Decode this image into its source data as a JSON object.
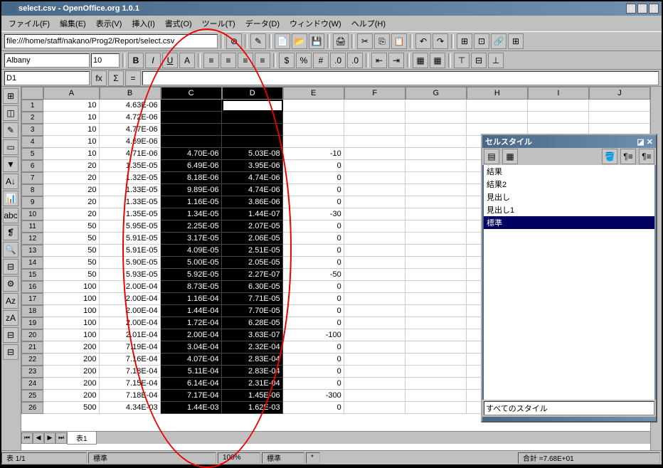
{
  "title": "select.csv - OpenOffice.org 1.0.1",
  "menus": [
    "ファイル(F)",
    "編集(E)",
    "表示(V)",
    "挿入(I)",
    "書式(O)",
    "ツール(T)",
    "データ(D)",
    "ウィンドウ(W)",
    "ヘルプ(H)"
  ],
  "url": "file:///home/staff/nakano/Prog2/Report/select.csv",
  "font": "Albany",
  "fontsize": "10",
  "cellref": "D1",
  "formula": "",
  "columns": [
    "A",
    "B",
    "C",
    "D",
    "E",
    "F",
    "G",
    "H",
    "I",
    "J"
  ],
  "selected_columns": [
    "C",
    "D"
  ],
  "active_cell": "D1",
  "sheet_tab": "表1",
  "status": {
    "sheet": "表 1/1",
    "style": "標準",
    "zoom": "100%",
    "mode": "標準",
    "marker": "*",
    "sum": "合計 =7.68E+01"
  },
  "styles_panel": {
    "title": "セルスタイル",
    "items": [
      "結果",
      "結果2",
      "見出し",
      "見出し1",
      "標準"
    ],
    "selected": "標準",
    "footer": "すべてのスタイル"
  },
  "rows": [
    {
      "n": 1,
      "A": "10",
      "B": "4.63E-06",
      "C": "",
      "D": "",
      "E": ""
    },
    {
      "n": 2,
      "A": "10",
      "B": "4.72E-06",
      "C": "",
      "D": "",
      "E": ""
    },
    {
      "n": 3,
      "A": "10",
      "B": "4.77E-06",
      "C": "",
      "D": "",
      "E": ""
    },
    {
      "n": 4,
      "A": "10",
      "B": "4.69E-06",
      "C": "",
      "D": "",
      "E": ""
    },
    {
      "n": 5,
      "A": "10",
      "B": "4.71E-06",
      "C": "4.70E-06",
      "D": "5.03E-08",
      "E": "-10"
    },
    {
      "n": 6,
      "A": "20",
      "B": "1.35E-05",
      "C": "6.49E-06",
      "D": "3.95E-06",
      "E": "0"
    },
    {
      "n": 7,
      "A": "20",
      "B": "1.32E-05",
      "C": "8.18E-06",
      "D": "4.74E-06",
      "E": "0"
    },
    {
      "n": 8,
      "A": "20",
      "B": "1.33E-05",
      "C": "9.89E-06",
      "D": "4.74E-06",
      "E": "0"
    },
    {
      "n": 9,
      "A": "20",
      "B": "1.33E-05",
      "C": "1.16E-05",
      "D": "3.86E-06",
      "E": "0"
    },
    {
      "n": 10,
      "A": "20",
      "B": "1.35E-05",
      "C": "1.34E-05",
      "D": "1.44E-07",
      "E": "-30"
    },
    {
      "n": 11,
      "A": "50",
      "B": "5.95E-05",
      "C": "2.25E-05",
      "D": "2.07E-05",
      "E": "0"
    },
    {
      "n": 12,
      "A": "50",
      "B": "5.91E-05",
      "C": "3.17E-05",
      "D": "2.06E-05",
      "E": "0"
    },
    {
      "n": 13,
      "A": "50",
      "B": "5.91E-05",
      "C": "4.09E-05",
      "D": "2.51E-05",
      "E": "0"
    },
    {
      "n": 14,
      "A": "50",
      "B": "5.90E-05",
      "C": "5.00E-05",
      "D": "2.05E-05",
      "E": "0"
    },
    {
      "n": 15,
      "A": "50",
      "B": "5.93E-05",
      "C": "5.92E-05",
      "D": "2.27E-07",
      "E": "-50"
    },
    {
      "n": 16,
      "A": "100",
      "B": "2.00E-04",
      "C": "8.73E-05",
      "D": "6.30E-05",
      "E": "0"
    },
    {
      "n": 17,
      "A": "100",
      "B": "2.00E-04",
      "C": "1.16E-04",
      "D": "7.71E-05",
      "E": "0"
    },
    {
      "n": 18,
      "A": "100",
      "B": "2.00E-04",
      "C": "1.44E-04",
      "D": "7.70E-05",
      "E": "0"
    },
    {
      "n": 19,
      "A": "100",
      "B": "2.00E-04",
      "C": "1.72E-04",
      "D": "6.28E-05",
      "E": "0"
    },
    {
      "n": 20,
      "A": "100",
      "B": "2.01E-04",
      "C": "2.00E-04",
      "D": "3.63E-07",
      "E": "-100"
    },
    {
      "n": 21,
      "A": "200",
      "B": "7.19E-04",
      "C": "3.04E-04",
      "D": "2.32E-04",
      "E": "0"
    },
    {
      "n": 22,
      "A": "200",
      "B": "7.16E-04",
      "C": "4.07E-04",
      "D": "2.83E-04",
      "E": "0"
    },
    {
      "n": 23,
      "A": "200",
      "B": "7.18E-04",
      "C": "5.11E-04",
      "D": "2.83E-04",
      "E": "0"
    },
    {
      "n": 24,
      "A": "200",
      "B": "7.15E-04",
      "C": "6.14E-04",
      "D": "2.31E-04",
      "E": "0"
    },
    {
      "n": 25,
      "A": "200",
      "B": "7.18E-04",
      "C": "7.17E-04",
      "D": "1.45E-06",
      "E": "-300"
    },
    {
      "n": 26,
      "A": "500",
      "B": "4.34E-03",
      "C": "1.44E-03",
      "D": "1.62E-03",
      "E": "0"
    }
  ]
}
